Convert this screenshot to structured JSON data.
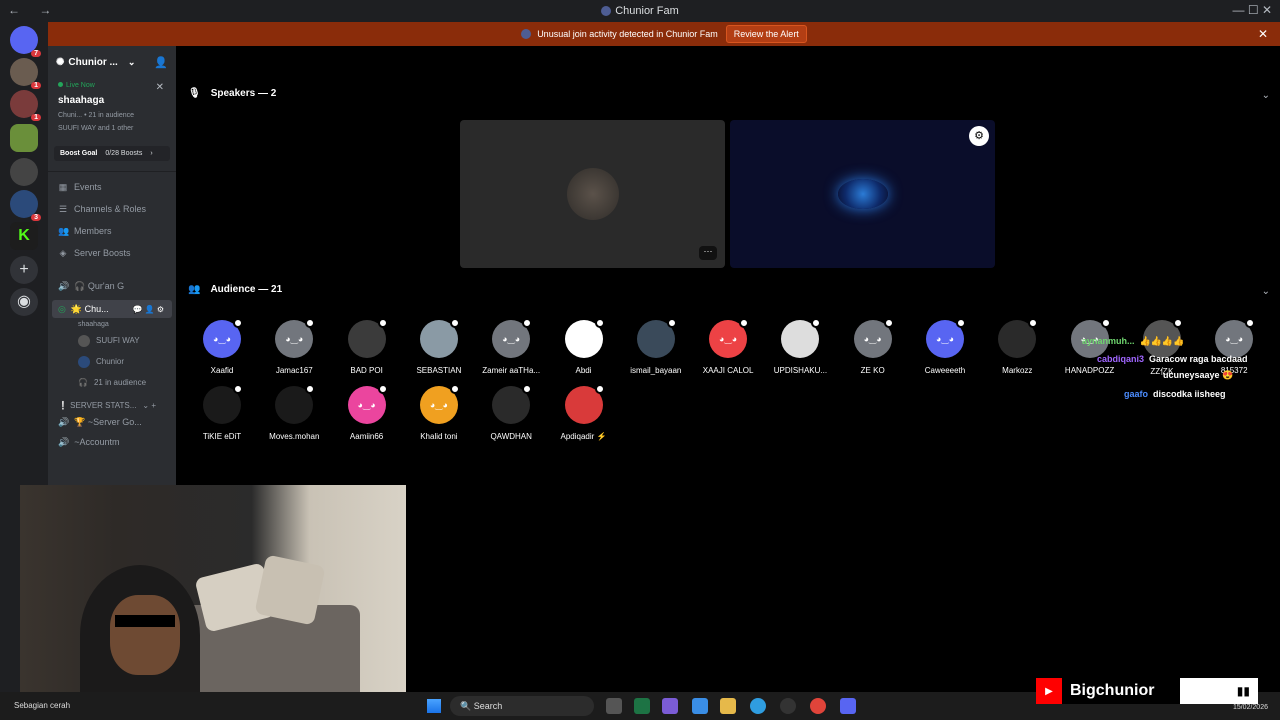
{
  "titlebar": {
    "title": "Chunior Fam",
    "nav": "← →",
    "window_controls": "— ☐ ✕"
  },
  "alert": {
    "text": "Unusual join activity detected in Chunior Fam",
    "button": "Review the Alert"
  },
  "rail": {
    "badges": [
      "7",
      "1",
      "1",
      "3"
    ]
  },
  "sidebar": {
    "server_name": "Chunior ...",
    "live_label": "Live Now",
    "live_name": "shaahaga",
    "live_meta1": "Chuni...  • 21 in audience",
    "live_meta2": "SUUFI WAY and 1 other",
    "boost_goal": "Boost Goal",
    "boost_count": "0/28 Boosts",
    "menu": [
      {
        "icon": "▦",
        "label": "Events"
      },
      {
        "icon": "☰",
        "label": "Channels & Roles"
      },
      {
        "icon": "👥",
        "label": "Members"
      },
      {
        "icon": "◈",
        "label": "Server Boosts"
      }
    ],
    "channels": {
      "quran": "🎧 Qur'an G",
      "active": "🌟 Chu...",
      "active_sub": "shaahaga",
      "subs": [
        "SUUFI WAY",
        "Chunior",
        "21 in audience"
      ],
      "category": "❕ SERVER STATS...",
      "server_go": "🏆 ~Server Go...",
      "accountm": "~Accountm"
    }
  },
  "main": {
    "speakers_label": "Speakers — 2",
    "audience_label": "Audience — 21",
    "more_label": "···",
    "audience": [
      {
        "name": "Xaafid",
        "color": "#5865f2"
      },
      {
        "name": "Jamac167",
        "color": "#72767d"
      },
      {
        "name": "BAD POI",
        "color": "#3b3b3b"
      },
      {
        "name": "SEBASTIAN",
        "color": "#8a9aa5"
      },
      {
        "name": "Zameir aaTHa...",
        "color": "#72767d"
      },
      {
        "name": "Abdi",
        "color": "#ffffff"
      },
      {
        "name": "ismail_bayaan",
        "color": "#3a4a5a"
      },
      {
        "name": "XAAJI CALOL",
        "color": "#ed4245"
      },
      {
        "name": "UPDISHAKU...",
        "color": "#dddddd"
      },
      {
        "name": "ZE KO",
        "color": "#72767d"
      },
      {
        "name": "Caweeeeth",
        "color": "#5865f2"
      },
      {
        "name": "Markozz",
        "color": "#2a2a2a"
      },
      {
        "name": "HANADPOZZ",
        "color": "#72767d"
      },
      {
        "name": "ZZ亿K",
        "color": "#555555"
      },
      {
        "name": "815372",
        "color": "#72767d"
      },
      {
        "name": "TiKIE eDiT",
        "color": "#1a1a1a"
      },
      {
        "name": "Moves.mohan",
        "color": "#1a1a1a"
      },
      {
        "name": "Aamiin66",
        "color": "#eb459e"
      },
      {
        "name": "Khalid toni",
        "color": "#f0a020"
      },
      {
        "name": "QAWDHAN",
        "color": "#2a2a2a"
      },
      {
        "name": "Apdiqadir ⚡",
        "color": "#d93a3a"
      }
    ]
  },
  "chat": [
    {
      "user": "aynanmuh...",
      "user_color": "#6fd66f",
      "text": "👍👍👍👍"
    },
    {
      "user": "cabdiqani3",
      "user_color": "#a066ff",
      "text": "Garacow raga bacdaad"
    },
    {
      "user": "",
      "user_color": "#ffffff",
      "text": "ucuneysaaye 😍"
    },
    {
      "user": "gaafo",
      "user_color": "#4c8dff",
      "text": "discodka iisheeg"
    }
  ],
  "taskbar": {
    "weather": "Sebagian cerah",
    "search_placeholder": "Search",
    "time": "15/02/2026"
  },
  "branding": {
    "channel": "Bigchunior",
    "bars": "▮▮"
  }
}
